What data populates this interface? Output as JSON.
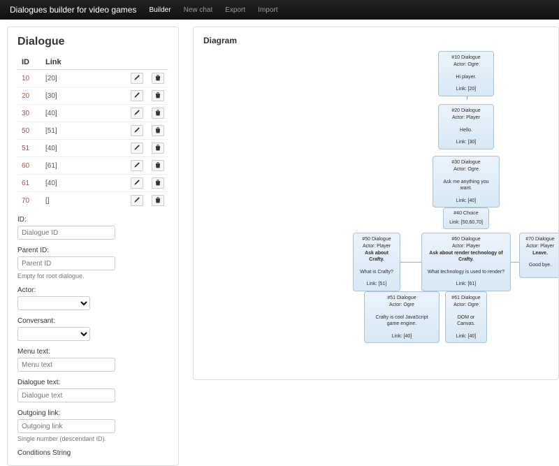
{
  "navbar": {
    "brand": "Dialogues builder for video games",
    "items": [
      {
        "label": "Builder",
        "active": true
      },
      {
        "label": "New chat",
        "active": false
      },
      {
        "label": "Export",
        "active": false
      },
      {
        "label": "Import",
        "active": false
      }
    ]
  },
  "dialogue": {
    "title": "Dialogue",
    "columns": {
      "id": "ID",
      "link": "Link"
    },
    "rows": [
      {
        "id": "10",
        "link": "[20]"
      },
      {
        "id": "20",
        "link": "[30]"
      },
      {
        "id": "30",
        "link": "[40]"
      },
      {
        "id": "50",
        "link": "[51]"
      },
      {
        "id": "51",
        "link": "[40]"
      },
      {
        "id": "60",
        "link": "[61]"
      },
      {
        "id": "61",
        "link": "[40]"
      },
      {
        "id": "70",
        "link": "[]"
      }
    ]
  },
  "form": {
    "id_label": "ID:",
    "id_placeholder": "Dialogue ID",
    "parent_label": "Parent ID:",
    "parent_placeholder": "Parent ID",
    "parent_help": "Empty for root dialogue.",
    "actor_label": "Actor:",
    "conversant_label": "Conversant:",
    "menu_label": "Menu text:",
    "menu_placeholder": "Menu text",
    "dialogue_label": "Dialogue text:",
    "dialogue_placeholder": "Dialogue text",
    "outgoing_label": "Outgoing link:",
    "outgoing_placeholder": "Outgoing link",
    "outgoing_help": "Single number (descendant ID).",
    "conditions_label": "Conditions String"
  },
  "diagram": {
    "title": "Diagram",
    "nodes": {
      "n10": {
        "title": "#10 Dialogue",
        "actor": "Actor: Ogre",
        "body": "Hi player.",
        "links": "Link: [20]"
      },
      "n20": {
        "title": "#20 Dialogue",
        "actor": "Actor: Player",
        "body": "Hello.",
        "links": "Link: [30]"
      },
      "n30": {
        "title": "#30 Dialogue",
        "actor": "Actor: Ogre",
        "body": "Ask me anything you want.",
        "links": "Link: [40]"
      },
      "n40": {
        "title": "#40 Choice",
        "links": "Link: [50,60,70]"
      },
      "n50": {
        "title": "#50 Dialogue",
        "actor": "Actor: Player",
        "menu": "Ask about Crafty.",
        "body": "What is Crafty?",
        "links": "Link: [51]"
      },
      "n60": {
        "title": "#60 Dialogue",
        "actor": "Actor: Player",
        "menu": "Ask about render technology of Crafty.",
        "body": "What technology is used to render?",
        "links": "Link: [61]"
      },
      "n70": {
        "title": "#70 Dialogue",
        "actor": "Actor: Player",
        "menu": "Leave.",
        "body": "Good bye.",
        "links": ""
      },
      "n51": {
        "title": "#51 Dialogue",
        "actor": "Actor: Ogre",
        "body": "Crafty is cool JavaScript game engine.",
        "links": "Link: [40]"
      },
      "n61": {
        "title": "#61 Dialogue",
        "actor": "Actor: Ogre",
        "body": "DOM or Canvas.",
        "links": "Link: [40]"
      }
    }
  }
}
